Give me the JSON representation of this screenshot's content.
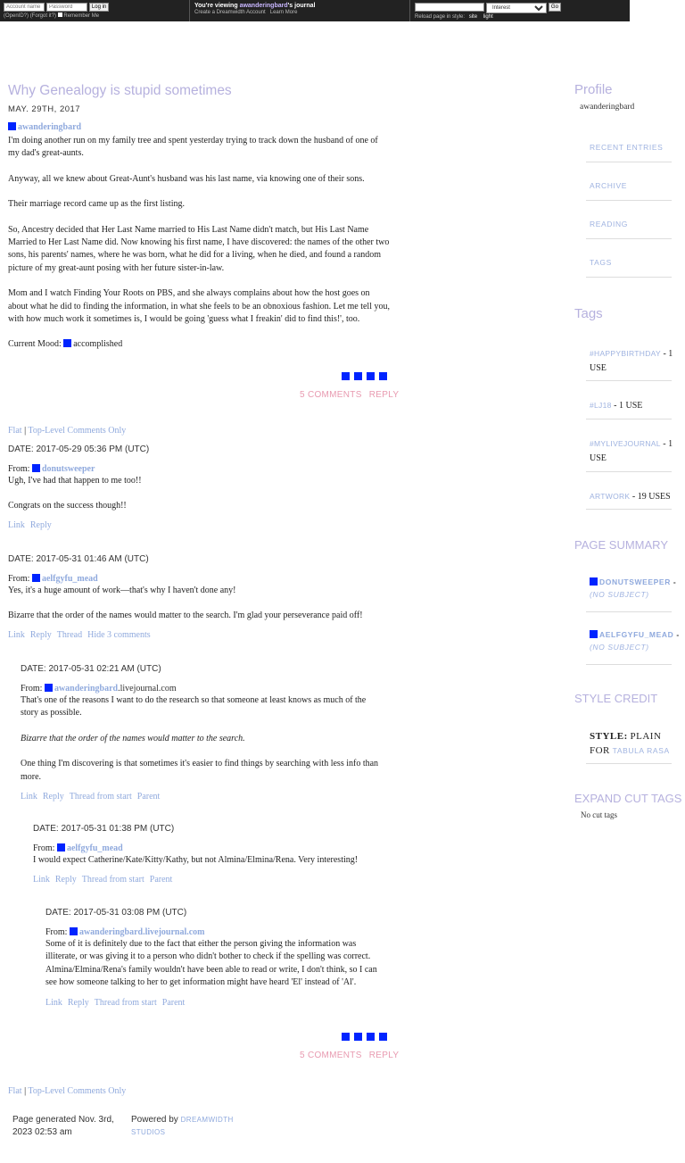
{
  "topbar": {
    "login": {
      "account_placeholder": "Account name",
      "password_placeholder": "Password",
      "login_button": "Log in",
      "openid": "(OpenID?)",
      "forgot": "(Forgot it?)",
      "remember": "Remember Me"
    },
    "viewing": {
      "prefix": "You're viewing",
      "user": "awanderingbard",
      "suffix": "'s journal",
      "create": "Create a Dreamwidth Account",
      "learn": "Learn More"
    },
    "search": {
      "select_value": "Interest",
      "go": "Go",
      "reload_label": "Reload page in style:",
      "site": "site",
      "light": "light"
    }
  },
  "entry": {
    "title": "Why Genealogy is stupid sometimes",
    "date": "MAY. 29TH, 2017",
    "poster": "awanderingbard",
    "paragraphs": [
      "I'm doing another run on my family tree and spent yesterday trying to track down the husband of one of my dad's great-aunts.",
      "Anyway, all we knew about Great-Aunt's husband was his last name, via knowing one of their sons.",
      "Their marriage record came up as the first listing.",
      "So, Ancestry decided that Her Last Name married to His Last Name didn't match, but His Last Name Married to Her Last Name did. Now knowing his first name, I have discovered: the names of the other two sons, his parents' names, where he was born, what he did for a living, when he died, and found a random picture of my great-aunt posing with her future sister-in-law.",
      "Mom and I watch Finding Your Roots on PBS, and she always complains about how the host goes on about what he did to finding the information, in what she feels to be an obnoxious fashion. Let me tell you, with how much work it sometimes is, I would be going 'guess what I freakin' did to find this!', too."
    ],
    "mood_label": "Current Mood:",
    "mood": "accomplished",
    "comments": "5 COMMENTS",
    "reply": "REPLY"
  },
  "nav": {
    "flat": "Flat",
    "sep": "|",
    "top": "Top-Level Comments Only"
  },
  "comments": [
    {
      "date": "DATE: 2017-05-29 05:36 PM (UTC)",
      "from": "From:",
      "user": "donutsweeper",
      "user_suffix": "",
      "lines": [
        "Ugh, I've had that happen to me too!!",
        "Congrats on the success though!!"
      ],
      "links": [
        "Link",
        "Reply"
      ]
    },
    {
      "date": "DATE: 2017-05-31 01:46 AM (UTC)",
      "from": "From:",
      "user": "aelfgyfu_mead",
      "user_suffix": "",
      "lines": [
        "Yes, it's a huge amount of work—that's why I haven't done any!",
        "Bizarre that the order of the names would matter to the search. I'm glad your perseverance paid off!"
      ],
      "links": [
        "Link",
        "Reply",
        "Thread",
        "Hide 3 comments"
      ]
    },
    {
      "date": "DATE: 2017-05-31 02:21 AM (UTC)",
      "from": "From:",
      "user": "awanderingbard",
      "user_suffix": ".livejournal.com",
      "lines": [
        "That's one of the reasons I want to do the research so that someone at least knows as much of the story as possible.",
        "Bizarre that the order of the names would matter to the search.",
        "One thing I'm discovering is that sometimes it's easier to find things by searching with less info than more."
      ],
      "links": [
        "Link",
        "Reply",
        "Thread from start",
        "Parent"
      ]
    },
    {
      "date": "DATE: 2017-05-31 01:38 PM (UTC)",
      "from": "From:",
      "user": "aelfgyfu_mead",
      "user_suffix": "",
      "lines": [
        "I would expect Catherine/Kate/Kitty/Kathy, but not Almina/Elmina/Rena. Very interesting!"
      ],
      "links": [
        "Link",
        "Reply",
        "Thread from start",
        "Parent"
      ]
    },
    {
      "date": "DATE: 2017-05-31 03:08 PM (UTC)",
      "from": "From:",
      "user": "awanderingbard",
      "user_suffix": ".livejournal.com",
      "lines": [
        "Some of it is definitely due to the fact that either the person giving the information was illiterate, or was giving it to a person who didn't bother to check if the spelling was correct. Almina/Elmina/Rena's family wouldn't have been able to read or write, I don't think, so I can see how someone talking to her to get information might have heard 'El' instead of 'Al'."
      ],
      "links": [
        "Link",
        "Reply",
        "Thread from start",
        "Parent"
      ]
    }
  ],
  "footer": {
    "generated": "Page generated Nov. 3rd, 2023 02:53 am",
    "powered": "Powered by",
    "dreamwidth": "DREAMWIDTH",
    "studios": "STUDIOS"
  },
  "sidebar": {
    "profile_title": "Profile",
    "profile_user": "awanderingbard",
    "nav": [
      "RECENT ENTRIES",
      "ARCHIVE",
      "READING",
      "TAGS"
    ],
    "tags_title": "Tags",
    "tags": [
      {
        "name": "#HAPPYBIRTHDAY",
        "count": "- 1 USE"
      },
      {
        "name": "#LJ18",
        "count": "- 1 USE"
      },
      {
        "name": "#MYLIVEJOURNAL",
        "count": "- 1 USE"
      },
      {
        "name": "ARTWORK",
        "count": "- 19 USES"
      }
    ],
    "summary_title": "PAGE SUMMARY",
    "summary": [
      {
        "user": "DONUTSWEEPER",
        "suffix": " -",
        "subject": "(NO SUBJECT)"
      },
      {
        "user": "AELFGYFU_MEAD",
        "suffix": " -",
        "subject": "(NO SUBJECT)"
      }
    ],
    "credit_title": "STYLE CREDIT",
    "style_label": "STYLE:",
    "style_value": "PLAIN",
    "for_label": "FOR",
    "for_value": "TABULA RASA",
    "expand_title": "EXPAND CUT TAGS",
    "expand_value": "No cut tags"
  },
  "colors": {
    "accent": "#b6b1de",
    "link": "#8fa9dd",
    "pink": "#e89ab0",
    "icon": "#0024ff",
    "topbar": "#222222"
  }
}
